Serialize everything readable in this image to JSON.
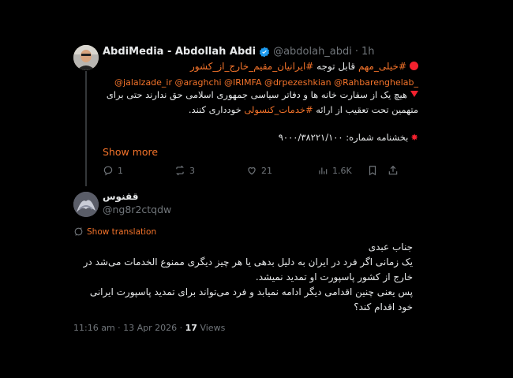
{
  "parent": {
    "display_name": "AbdiMedia - Abdollah Abdi",
    "handle": "@abdolah_abdi",
    "time": "1h",
    "line1_hashtag1": "#خیلی_مهم",
    "line1_text": " قابل توجه ",
    "line1_hashtag2": "#ایرانیان_مقیم_خارج_از_کشور",
    "mentions": "@jalalzade_ir @araghchi @IRIMFA @drpezeshkian @Rahbarenghelab_",
    "line3": "هیچ یک از سفارت خانه ها و دفاتر سیاسی جمهوری اسلامی حق ندارند حتی برای",
    "line4_text": "متهمین تحت تعقیب از ارائه ",
    "line4_hashtag": "#خدمات_کنسولی",
    "line4_end": " خودداری کنند.",
    "circular": "بخشنامه شماره: ۹۰۰۰/۳۸۲۲۱/۱۰۰",
    "show_more": "Show more",
    "stats": {
      "replies": "1",
      "reposts": "3",
      "likes": "21",
      "views": "1.6K"
    }
  },
  "reply": {
    "display_name": "ققنوس",
    "handle": "@ng8r2ctqdw",
    "show_translation": "Show translation",
    "lines": [
      "جناب عبدی",
      "یک زمانی اگر فرد در ایران به دلیل بدهی یا هر چیز دیگری ممنوع الخدمات می‌شد در",
      "خارج از کشور پاسپورت او تمدید نمیشد.",
      "پس یعنی چنین اقدامی دیگر ادامه نمیابد و فرد می‌تواند برای تمدید پاسپورت ایرانی",
      "خود اقدام کند؟"
    ],
    "timestamp": "11:16 am · 13 Apr 2026 · ",
    "views_count": "17",
    "views_label": " Views"
  },
  "colors": {
    "background": "#000000",
    "accent": "#f4732a",
    "verified": "#1d9bf0",
    "muted": "#71767b"
  },
  "icons": [
    "verified-badge-icon",
    "reply-icon",
    "repost-icon",
    "like-icon",
    "views-icon",
    "bookmark-icon",
    "share-icon",
    "translate-icon",
    "red-circle-emoji",
    "red-triangle-emoji",
    "collision-emoji"
  ]
}
